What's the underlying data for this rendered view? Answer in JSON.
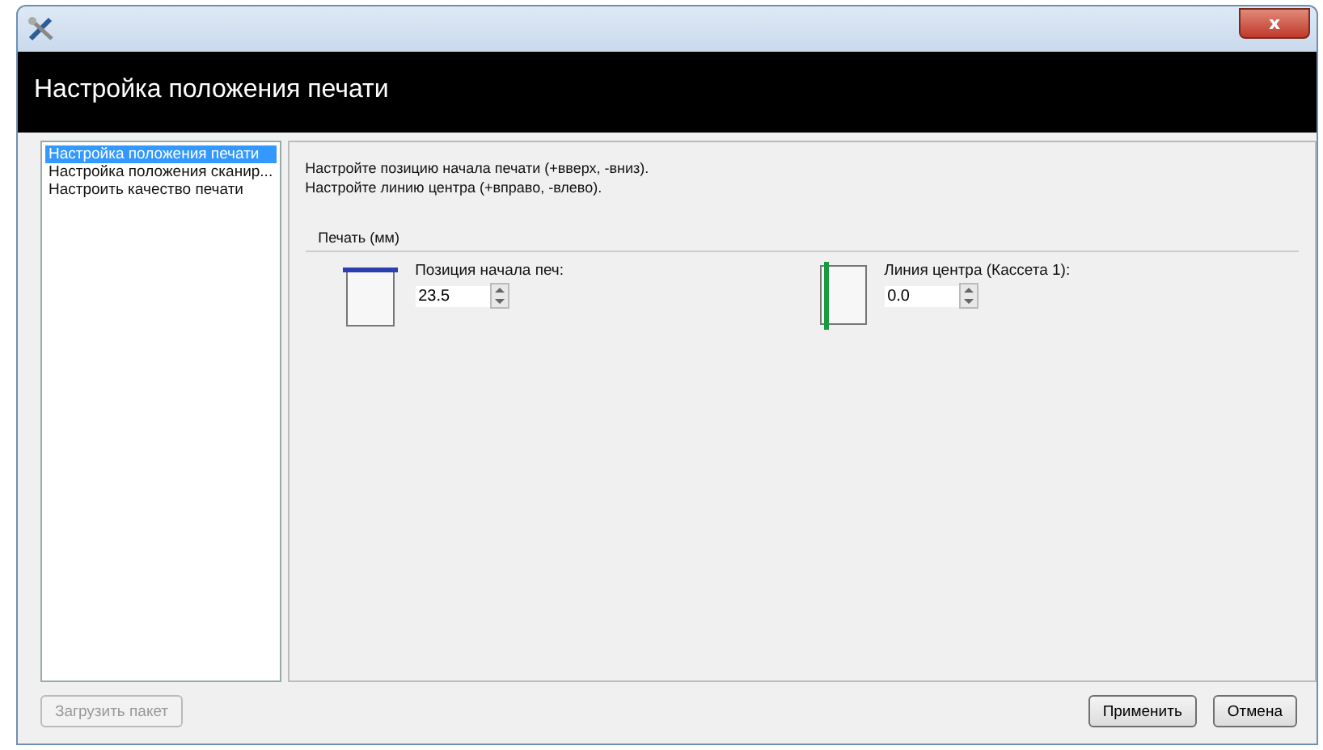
{
  "window": {
    "close_glyph": "x"
  },
  "header": {
    "title": "Настройка положения печати"
  },
  "sidebar": {
    "items": [
      {
        "label": "Настройка положения печати",
        "selected": true
      },
      {
        "label": "Настройка положения сканир...",
        "selected": false
      },
      {
        "label": "Настроить качество печати",
        "selected": false
      }
    ]
  },
  "main": {
    "instructions": [
      "Настройте позицию начала печати (+вверх, -вниз).",
      "Настройте линию центра (+вправо, -влево)."
    ],
    "group_title": "Печать (мм)",
    "settings": [
      {
        "kind": "top",
        "label": "Позиция начала печ:",
        "value": "23.5"
      },
      {
        "kind": "center",
        "label": "Линия центра (Кассета 1):",
        "value": "0.0"
      }
    ]
  },
  "footer": {
    "load_button": {
      "label": "Загрузить пакет",
      "disabled": true
    },
    "buttons": [
      "Применить",
      "Отмена"
    ]
  }
}
